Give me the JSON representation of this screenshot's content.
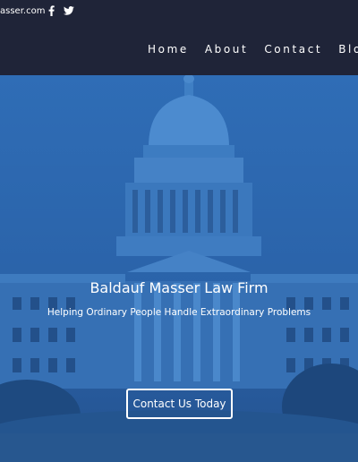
{
  "topbar": {
    "email": "asser.com",
    "social": [
      {
        "icon": "facebook-icon",
        "label": "f"
      },
      {
        "icon": "twitter-icon"
      }
    ]
  },
  "nav": {
    "items": [
      {
        "label": "Home"
      },
      {
        "label": "About"
      },
      {
        "label": "Contact"
      },
      {
        "label": "Blo"
      }
    ]
  },
  "hero": {
    "title": "Baldauf Masser Law Firm",
    "subtitle": "Helping Ordinary People Handle Extraordinary Problems",
    "cta_label": "Contact Us Today"
  },
  "colors": {
    "header_bg": "#1f2438",
    "hero_overlay": "#2b67b0",
    "text": "#ffffff"
  }
}
